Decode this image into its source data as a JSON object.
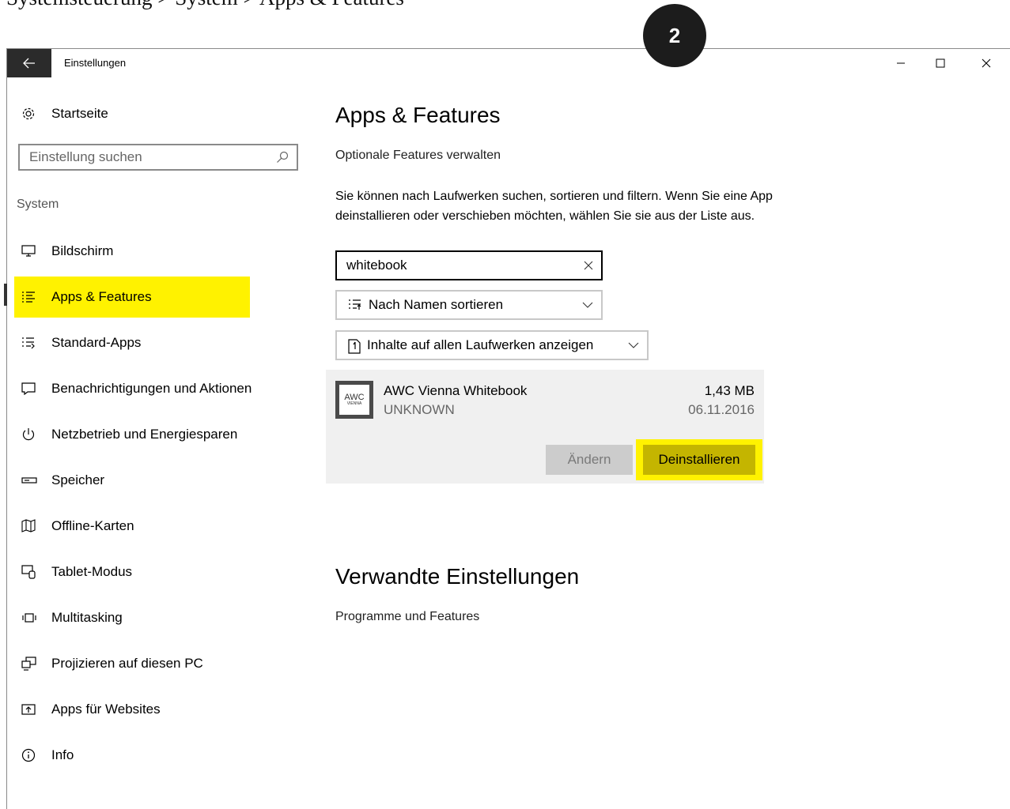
{
  "caption": "Systemsteuerung > System > Apps & Features",
  "step_badge": "2",
  "window": {
    "title": "Einstellungen",
    "controls": {
      "minimize": "–",
      "maximize": "☐",
      "close": "✕"
    }
  },
  "sidebar": {
    "home_label": "Startseite",
    "search_placeholder": "Einstellung suchen",
    "section": "System",
    "items": [
      {
        "label": "Bildschirm",
        "icon": "monitor-icon"
      },
      {
        "label": "Apps & Features",
        "icon": "apps-list-icon",
        "active": true
      },
      {
        "label": "Standard-Apps",
        "icon": "default-apps-icon"
      },
      {
        "label": "Benachrichtigungen und Aktionen",
        "icon": "notification-icon"
      },
      {
        "label": "Netzbetrieb und Energiesparen",
        "icon": "power-icon"
      },
      {
        "label": "Speicher",
        "icon": "storage-icon"
      },
      {
        "label": "Offline-Karten",
        "icon": "map-icon"
      },
      {
        "label": "Tablet-Modus",
        "icon": "tablet-icon"
      },
      {
        "label": "Multitasking",
        "icon": "multitasking-icon"
      },
      {
        "label": "Projizieren auf diesen PC",
        "icon": "project-icon"
      },
      {
        "label": "Apps für Websites",
        "icon": "website-icon"
      },
      {
        "label": "Info",
        "icon": "info-icon"
      }
    ]
  },
  "main": {
    "title": "Apps & Features",
    "optional_features_link": "Optionale Features verwalten",
    "description": "Sie können nach Laufwerken suchen, sortieren und filtern. Wenn Sie eine App deinstallieren oder verschieben möchten, wählen Sie sie aus der Liste aus.",
    "search_value": "whitebook",
    "sort_label": "Nach Namen sortieren",
    "drive_filter_label": "Inhalte auf allen Laufwerken anzeigen",
    "app": {
      "logo_text": "AWC",
      "logo_subtext": "VIENNA",
      "name": "AWC Vienna Whitebook",
      "publisher": "UNKNOWN",
      "size": "1,43 MB",
      "date": "06.11.2016",
      "change_label": "Ändern",
      "uninstall_label": "Deinstallieren"
    },
    "related_title": "Verwandte Einstellungen",
    "related_link": "Programme und Features"
  },
  "colors": {
    "highlight": "#fff200",
    "uninstall_button": "#c4b500",
    "titlebar_back": "#2b2b2b",
    "app_card_bg": "#f0f0f0"
  }
}
